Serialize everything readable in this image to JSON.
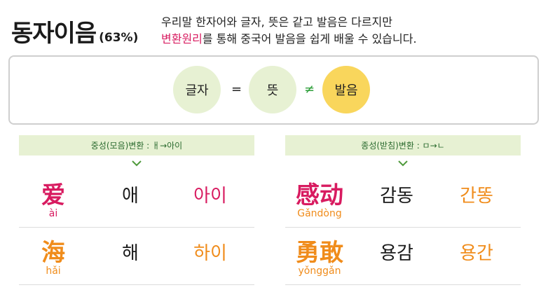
{
  "header": {
    "title": "동자이음",
    "percent": "(63%)",
    "desc_line1": "우리말 한자어와 글자, 뜻은 같고 발음은 다르지만",
    "desc_line2_hl": "변환원리",
    "desc_line2_rest": "를 통해 중국어 발음을 쉽게 배울 수 있습니다."
  },
  "formula": {
    "c1": "글자",
    "eq": "=",
    "c2": "뜻",
    "ne": "≠",
    "c3": "발음"
  },
  "colors": {
    "pink": "#d81b60",
    "orange": "#f08c1b",
    "green_bg": "#e7f1d3",
    "yellow": "#f9d65c"
  },
  "left": {
    "header": "중성(모음)변환 : ㅐ→아이",
    "chevron": "chevron-down-icon",
    "rows": [
      {
        "hanzi": "爱",
        "pinyin": "ài",
        "korean": "애",
        "changed": "아이"
      },
      {
        "hanzi": "海",
        "pinyin": "hǎi",
        "korean": "해",
        "changed": "하이"
      }
    ]
  },
  "right": {
    "header": "종성(받침)변환 : ㅁ→ㄴ",
    "chevron": "chevron-down-icon",
    "rows": [
      {
        "hanzi": "感动",
        "pinyin": "Gǎndòng",
        "korean": "감동",
        "changed": "간똥"
      },
      {
        "hanzi": "勇敢",
        "pinyin": "yǒnggǎn",
        "korean": "용감",
        "changed": "용간"
      }
    ]
  }
}
